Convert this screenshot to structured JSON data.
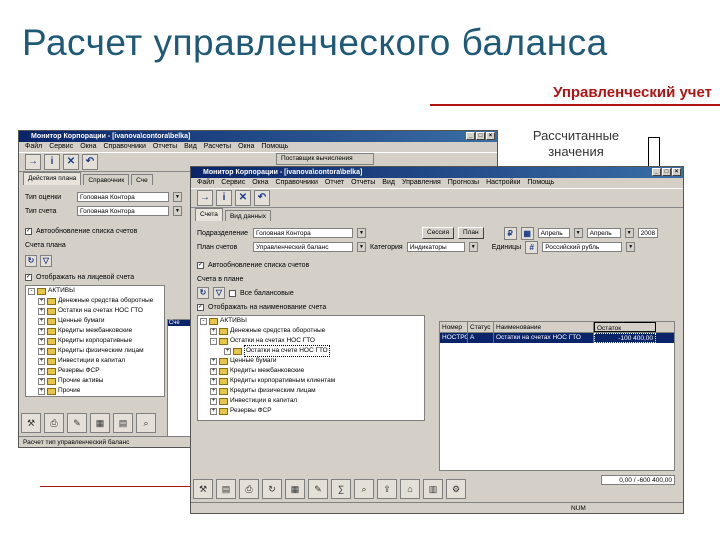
{
  "slide": {
    "title": "Расчет управленческого баланса",
    "subtitle": "Управленческий учет",
    "callout": "Рассчитанные значения"
  },
  "colors": {
    "title": "#1e5a78",
    "accent": "#b01212",
    "titlebar": "#0a246a",
    "selection": "#0a246a"
  },
  "back_window": {
    "title": "Монитор Корпорации - [ivanova\\contora\\belka]",
    "menu": [
      "Файл",
      "Сервис",
      "Окна",
      "Справочники",
      "Отчеты",
      "Вид",
      "Расчеты",
      "Окна",
      "Помощь"
    ],
    "tabs": [
      "Действия плана",
      "Справочник",
      "Сче"
    ],
    "fields": [
      {
        "label": "Тип оценки",
        "value": "Головная Контора"
      },
      {
        "label": "Тип счета",
        "value": "Головная Контора"
      }
    ],
    "checkbox1": "Автообновление списка счетов",
    "section": "Счета плана",
    "checkbox2": "Отображать на лицевой счета",
    "tree": [
      "АКТИВЫ",
      "Денежные средства оборотные",
      "Остатки на счетах НОС ГТО",
      "Ценные бумаги",
      "Кредиты межбанковские",
      "Кредиты корпоративные",
      "Кредиты физическим лицам",
      "Инвестиции в капитал",
      "Резервы ФСР",
      "Прочие активы",
      "Прочие"
    ],
    "status": "Расчет тип управленческий баланс",
    "side_labels": [
      "Сче"
    ]
  },
  "front_window": {
    "title": "Монитор Корпорации - [ivanova\\contora\\belka]",
    "dropdown": "Поставщик вычисления",
    "menu": [
      "Файл",
      "Сервис",
      "Окна",
      "Справочники",
      "Отчет",
      "Отчеты",
      "Вид",
      "Управления",
      "Прогнозы",
      "Настройки",
      "Помощь"
    ],
    "tab1": "Счета",
    "tab2": "Вид данных",
    "row1": {
      "label": "Подразделение",
      "value": "Головная Контора",
      "btn1": "Сессия",
      "btn2": "План"
    },
    "row2": {
      "label": "План счетов",
      "value": "Управленческий баланс",
      "label2": "Категория",
      "value2": "Индикаторы"
    },
    "period": {
      "label": "Период",
      "month_from": "Апрель",
      "month_to": "Апрель",
      "year": "2008",
      "currency_label": "Единицы",
      "currency": "Российский рубль"
    },
    "checkbox1": "Автообновление списка счетов",
    "section": "Счета в плане",
    "checkbox2": "Все балансовые",
    "checkbox3": "Отображать на наименование счета",
    "tree": [
      "АКТИВЫ",
      "Денежные средства оборотные",
      "Остатки на счетах НОС ГТО",
      "Остатки на счете НОС ГТО",
      "Ценные бумаги",
      "Кредиты межбанковские",
      "Кредиты корпоративным клиентам",
      "Кредиты физическим лицам",
      "Инвестиции в капитал",
      "Резервы ФСР"
    ],
    "grid": {
      "columns": [
        "Номер",
        "Статус",
        "Наименование",
        "Остаток"
      ],
      "rows": [
        {
          "num": "НОСТРО",
          "status": "А",
          "name": "Остатки на счетах НОС ГТО",
          "value": "-100 400,00"
        }
      ]
    },
    "grid_footer": "0,00 / -600 400,00",
    "status": "NUM"
  }
}
